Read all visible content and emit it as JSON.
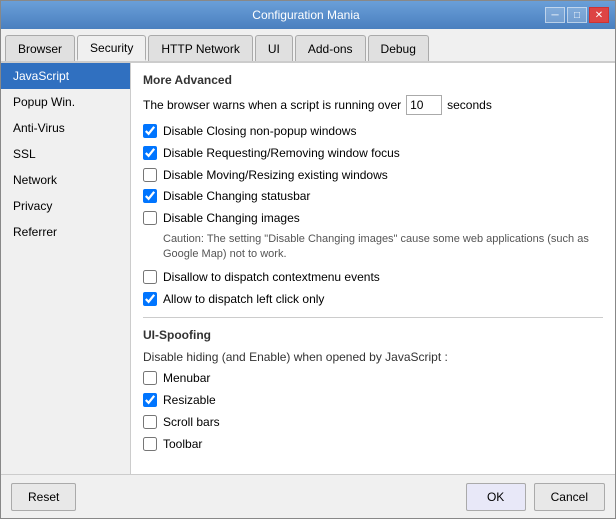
{
  "window": {
    "title": "Configuration Mania",
    "close_label": "✕",
    "min_label": "─",
    "max_label": "□"
  },
  "tabs": [
    {
      "id": "browser",
      "label": "Browser",
      "active": false
    },
    {
      "id": "security",
      "label": "Security",
      "active": true
    },
    {
      "id": "http",
      "label": "HTTP Network",
      "active": false
    },
    {
      "id": "ui",
      "label": "UI",
      "active": false
    },
    {
      "id": "addons",
      "label": "Add-ons",
      "active": false
    },
    {
      "id": "debug",
      "label": "Debug",
      "active": false
    }
  ],
  "sidebar": {
    "items": [
      {
        "id": "javascript",
        "label": "JavaScript",
        "active": true
      },
      {
        "id": "popup",
        "label": "Popup Win.",
        "active": false
      },
      {
        "id": "antivirus",
        "label": "Anti-Virus",
        "active": false
      },
      {
        "id": "ssl",
        "label": "SSL",
        "active": false
      },
      {
        "id": "network",
        "label": "Network",
        "active": false
      },
      {
        "id": "privacy",
        "label": "Privacy",
        "active": false
      },
      {
        "id": "referrer",
        "label": "Referrer",
        "active": false
      }
    ]
  },
  "content": {
    "section1": {
      "title": "More Advanced",
      "script_timeout_label": "The browser warns when a script is running over",
      "script_timeout_value": "10",
      "script_timeout_suffix": "seconds"
    },
    "checkboxes": [
      {
        "id": "close-nonpopup",
        "label": "Disable Closing non-popup windows",
        "checked": true
      },
      {
        "id": "focus",
        "label": "Disable Requesting/Removing window focus",
        "checked": true
      },
      {
        "id": "move-resize",
        "label": "Disable Moving/Resizing existing windows",
        "checked": false
      },
      {
        "id": "statusbar",
        "label": "Disable Changing statusbar",
        "checked": true
      },
      {
        "id": "images",
        "label": "Disable Changing images",
        "checked": false
      }
    ],
    "caution_text": "Caution: The setting \"Disable Changing images\" cause some web applications (such as Google Map) not to work.",
    "checkboxes2": [
      {
        "id": "contextmenu",
        "label": "Disallow to dispatch contextmenu events",
        "checked": false
      },
      {
        "id": "leftclick",
        "label": "Allow to dispatch left click only",
        "checked": true
      }
    ],
    "section2": {
      "title": "UI-Spoofing",
      "subtitle": "Disable hiding (and Enable) when opened by JavaScript :"
    },
    "checkboxes3": [
      {
        "id": "menubar",
        "label": "Menubar",
        "checked": false
      },
      {
        "id": "resizable",
        "label": "Resizable",
        "checked": true
      },
      {
        "id": "scrollbars",
        "label": "Scroll bars",
        "checked": false
      },
      {
        "id": "toolbar",
        "label": "Toolbar",
        "checked": false
      }
    ]
  },
  "footer": {
    "reset_label": "Reset",
    "ok_label": "OK",
    "cancel_label": "Cancel"
  }
}
